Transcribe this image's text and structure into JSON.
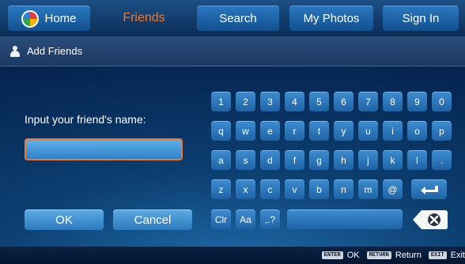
{
  "nav": {
    "tabs": [
      {
        "label": "Home",
        "icon": "app-logo-icon"
      },
      {
        "label": "Friends",
        "active": true
      },
      {
        "label": "Search"
      },
      {
        "label": "My Photos"
      },
      {
        "label": "Sign In"
      }
    ],
    "active_color": "#f07828"
  },
  "subheader": {
    "icon": "person-icon",
    "title": "Add Friends"
  },
  "form": {
    "prompt": "Input your friend's name:",
    "name_value": "",
    "ok_label": "OK",
    "cancel_label": "Cancel"
  },
  "keyboard": {
    "rows": [
      [
        "1",
        "2",
        "3",
        "4",
        "5",
        "6",
        "7",
        "8",
        "9",
        "0"
      ],
      [
        "q",
        "w",
        "e",
        "r",
        "t",
        "y",
        "u",
        "i",
        "o",
        "p"
      ],
      [
        "a",
        "s",
        "d",
        "f",
        "g",
        "h",
        "j",
        "k",
        "l",
        "."
      ],
      [
        "z",
        "x",
        "c",
        "v",
        "b",
        "n",
        "m",
        "@"
      ]
    ],
    "enter_icon": "enter-arrow-icon",
    "clr_label": "Clr",
    "case_label": "Aa",
    "symbols_label": ",.?",
    "space_label": "",
    "backspace_icon": "backspace-icon"
  },
  "footer": {
    "hints": [
      {
        "key": "ENTER",
        "label": "OK"
      },
      {
        "key": "RETURN",
        "label": "Return"
      },
      {
        "key": "EXIT",
        "label": "Exit"
      }
    ]
  }
}
